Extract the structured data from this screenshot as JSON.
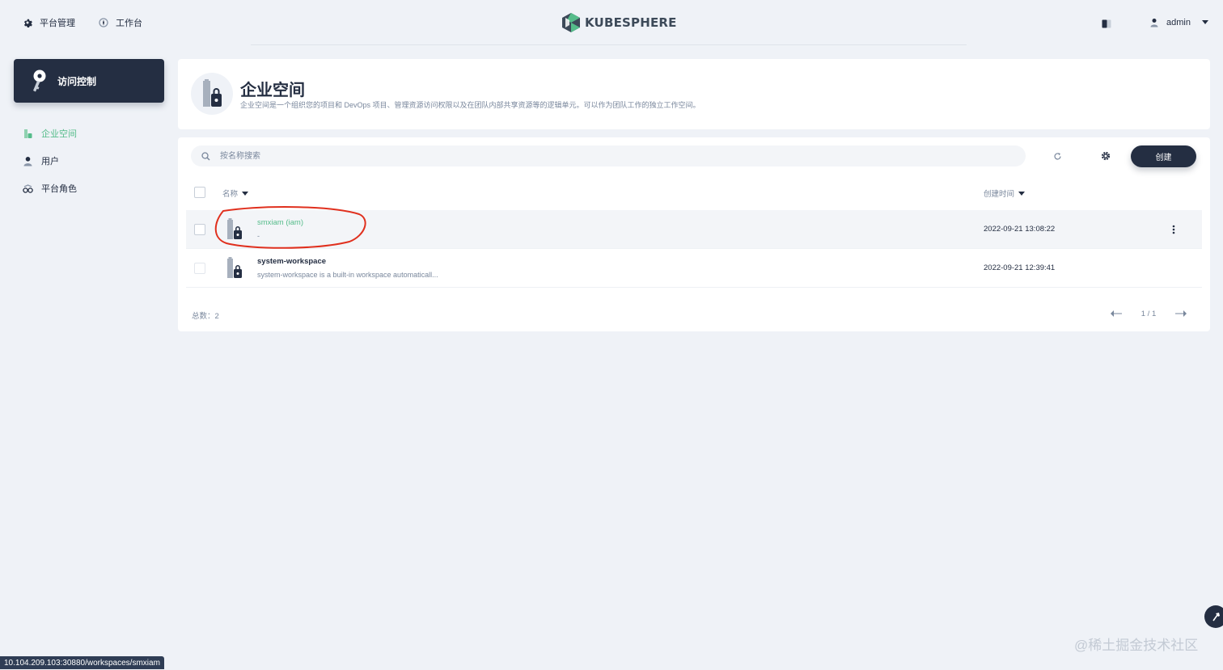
{
  "topbar": {
    "platform_label": "平台管理",
    "workbench_label": "工作台",
    "logo_text": "KUBESPHERE",
    "username": "admin"
  },
  "sidebar": {
    "card_title": "访问控制",
    "items": [
      {
        "label": "企业空间",
        "icon": "workspace-icon",
        "active": true
      },
      {
        "label": "用户",
        "icon": "user-icon",
        "active": false
      },
      {
        "label": "平台角色",
        "icon": "role-icon",
        "active": false
      }
    ]
  },
  "banner": {
    "title": "企业空间",
    "description": "企业空间是一个组织您的项目和 DevOps 项目、管理资源访问权限以及在团队内部共享资源等的逻辑单元。可以作为团队工作的独立工作空间。"
  },
  "toolbar": {
    "search_placeholder": "按名称搜索",
    "create_label": "创建"
  },
  "table": {
    "columns": {
      "name": "名称",
      "created": "创建时间"
    },
    "rows": [
      {
        "name": "smxiam (iam)",
        "description": "-",
        "created": "2022-09-21 13:08:22"
      },
      {
        "name": "system-workspace",
        "description": "system-workspace is a built-in workspace automaticall...",
        "created": "2022-09-21 12:39:41"
      }
    ]
  },
  "footer": {
    "total": "总数：2",
    "page": "1 / 1"
  },
  "status_url": "10.104.209.103:30880/workspaces/smxiam",
  "watermark": "@稀土掘金技术社区",
  "colors": {
    "accent": "#55bc8a",
    "dark": "#242e42",
    "background": "#eff2f7",
    "annotation": "#e0301e"
  }
}
